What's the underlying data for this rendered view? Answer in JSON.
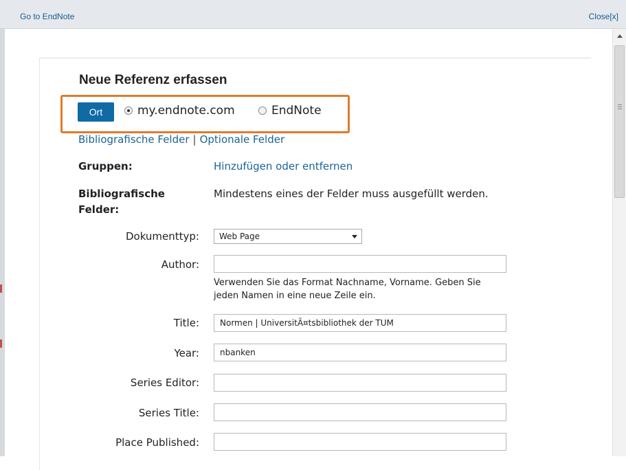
{
  "topbar": {
    "goto_label": "Go to EndNote",
    "close_label": "Close[x]"
  },
  "form": {
    "title": "Neue Referenz erfassen",
    "location": {
      "button_label": "Ort",
      "options": [
        {
          "label": "my.endnote.com",
          "selected": true
        },
        {
          "label": "EndNote",
          "selected": false
        }
      ]
    },
    "tabs": {
      "bibliographic": "Bibliografische Felder",
      "separator": "|",
      "optional": "Optionale Felder"
    },
    "groups": {
      "label": "Gruppen:",
      "action": "Hinzufügen oder entfernen"
    },
    "bib_fields": {
      "label_line1": "Bibliografische",
      "label_line2": "Felder:",
      "note": "Mindestens eines der Felder muss ausgefüllt werden."
    },
    "fields": {
      "doctype": {
        "label": "Dokumenttyp:",
        "value": "Web Page"
      },
      "author": {
        "label": "Author:",
        "value": "",
        "hint_line1": "Verwenden Sie das Format Nachname, Vorname. Geben Sie",
        "hint_line2": "jeden Namen in eine neue Zeile ein."
      },
      "title": {
        "label": "Title:",
        "value": "Normen | UniversitÃ¤tsbibliothek der TUM"
      },
      "year": {
        "label": "Year:",
        "value": "nbanken"
      },
      "series_editor": {
        "label": "Series Editor:",
        "value": ""
      },
      "series_title": {
        "label": "Series Title:",
        "value": ""
      },
      "place_published": {
        "label": "Place Published:",
        "value": ""
      }
    }
  },
  "colors": {
    "accent": "#0f6aa6",
    "highlight_border": "#e07a2c",
    "link": "#1a6496"
  }
}
